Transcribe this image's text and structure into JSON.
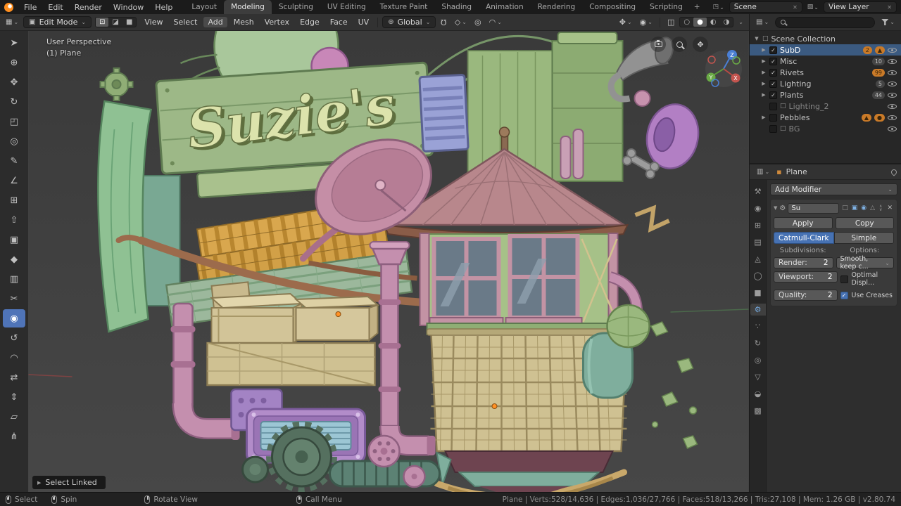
{
  "topbar": {
    "menus": [
      "File",
      "Edit",
      "Render",
      "Window",
      "Help"
    ],
    "workspaces": [
      "Layout",
      "Modeling",
      "Sculpting",
      "UV Editing",
      "Texture Paint",
      "Shading",
      "Animation",
      "Rendering",
      "Compositing",
      "Scripting"
    ],
    "active_workspace": "Modeling",
    "new_workspace_label": "+",
    "scene": "Scene",
    "view_layer": "View Layer"
  },
  "viewport_header": {
    "mode": "Edit Mode",
    "menus": [
      "View",
      "Select",
      "Add",
      "Mesh"
    ],
    "mesh_menus": [
      "Vertex",
      "Edge",
      "Face",
      "UV"
    ],
    "orientation": "Global"
  },
  "toolbar": {
    "active_tool": "poly-build",
    "tools": [
      {
        "name": "select-box",
        "glyph": "➤"
      },
      {
        "name": "cursor",
        "glyph": "⊕"
      },
      {
        "name": "move",
        "glyph": "✥"
      },
      {
        "name": "rotate",
        "glyph": "↻"
      },
      {
        "name": "scale",
        "glyph": "◰"
      },
      {
        "name": "transform",
        "glyph": "◎"
      },
      {
        "name": "annotate",
        "glyph": "✎"
      },
      {
        "name": "measure",
        "glyph": "∠"
      },
      {
        "name": "add-cube",
        "glyph": "⊞"
      },
      {
        "name": "extrude-region",
        "glyph": "⇧"
      },
      {
        "name": "inset-faces",
        "glyph": "▣"
      },
      {
        "name": "bevel",
        "glyph": "◆"
      },
      {
        "name": "loop-cut",
        "glyph": "▥"
      },
      {
        "name": "knife",
        "glyph": "✂"
      },
      {
        "name": "poly-build",
        "glyph": "◉"
      },
      {
        "name": "spin",
        "glyph": "↺"
      },
      {
        "name": "smooth",
        "glyph": "◠"
      },
      {
        "name": "edge-slide",
        "glyph": "⇄"
      },
      {
        "name": "shrink-fatten",
        "glyph": "⇕"
      },
      {
        "name": "shear",
        "glyph": "▱"
      },
      {
        "name": "rip-region",
        "glyph": "⋔"
      }
    ]
  },
  "viewport": {
    "perspective_label": "User Perspective",
    "object_label": "(1) Plane",
    "sign_text": "Suzie's",
    "select_linked_label": "Select Linked",
    "gizmo": {
      "x": "X",
      "y": "Y",
      "z": "Z"
    }
  },
  "outliner": {
    "root": "Scene Collection",
    "rows": [
      {
        "name": "SubD",
        "badge": "2",
        "checked": true,
        "selected": true
      },
      {
        "name": "Misc",
        "badge": "10",
        "checked": true
      },
      {
        "name": "Rivets",
        "badge": "99",
        "checked": true
      },
      {
        "name": "Lighting",
        "badge": "5",
        "checked": true
      },
      {
        "name": "Plants",
        "badge": "44",
        "checked": true
      },
      {
        "name": "Lighting_2",
        "badge": "",
        "checked": false
      },
      {
        "name": "Pebbles",
        "badge": "",
        "checked": false
      },
      {
        "name": "BG",
        "badge": "",
        "checked": false
      }
    ]
  },
  "properties": {
    "breadcrumb_object": "Plane",
    "add_modifier_label": "Add Modifier",
    "tabs": [
      {
        "name": "tool",
        "glyph": "⚒"
      },
      {
        "name": "render",
        "glyph": "◉"
      },
      {
        "name": "output",
        "glyph": "⊞"
      },
      {
        "name": "view-layer",
        "glyph": "▤"
      },
      {
        "name": "scene",
        "glyph": "◬"
      },
      {
        "name": "world",
        "glyph": "◯"
      },
      {
        "name": "object",
        "glyph": "■"
      },
      {
        "name": "modifiers",
        "glyph": "⚙"
      },
      {
        "name": "particles",
        "glyph": "∵"
      },
      {
        "name": "physics",
        "glyph": "↻"
      },
      {
        "name": "constraints",
        "glyph": "◎"
      },
      {
        "name": "object-data",
        "glyph": "▽"
      },
      {
        "name": "material",
        "glyph": "◒"
      },
      {
        "name": "texture",
        "glyph": "▩"
      }
    ],
    "modifier": {
      "name": "Su",
      "apply_label": "Apply",
      "copy_label": "Copy",
      "catmull_label": "Catmull-Clark",
      "simple_label": "Simple",
      "subdivisions_label": "Subdivisions:",
      "options_label": "Options:",
      "render_label": "Render:",
      "render_value": "2",
      "viewport_label": "Viewport:",
      "viewport_value": "2",
      "quality_label": "Quality:",
      "quality_value": "2",
      "uv_smooth_value": "Smooth, keep c...",
      "optimal_display_label": "Optimal Displ...",
      "use_creases_label": "Use Creases"
    }
  },
  "statusbar": {
    "hints": [
      "Select",
      "Spin",
      "Rotate View",
      "Call Menu"
    ],
    "stats": "Plane | Verts:528/14,636 | Edges:1,036/27,766 | Faces:518/13,266 | Tris:27,108 | Mem: 1.26 GB | v2.80.74"
  },
  "icons": {
    "chevron_down": "⌄",
    "tri_down": "▼",
    "tri_right": "▶",
    "check": "✓",
    "close": "✕",
    "plus": "+",
    "up": "∧",
    "down": "∨",
    "magnet": "Ω",
    "globe": "⊕",
    "prop_edit": "◎",
    "falloff": "◠",
    "xray": "◫",
    "shade_wire": "○",
    "shade_solid": "●",
    "shade_material": "◐",
    "shade_render": "◑",
    "vertex_mode": "⊡",
    "edge_mode": "◪",
    "face_mode": "■",
    "editor_3d": "▦",
    "outliner_editor": "▤",
    "properties_editor": "▥",
    "scene": "◳",
    "view_layer": "▧",
    "mode_cube": "▣",
    "overlays": "◉",
    "collection": "□",
    "object_square": "▪",
    "modifier_gear": "⚙",
    "editmode": "□",
    "viewport_toggle": "▣",
    "render_toggle": "◉",
    "cage": "△",
    "orange_mesh": "▲",
    "orange_mat": "●",
    "snap_to": "◇",
    "pan": "✥"
  },
  "colors": {
    "accent": "#4772b3",
    "selection": "#3b5a80",
    "badge_orange": "#c97a28",
    "viewport_bg": "#414141"
  }
}
